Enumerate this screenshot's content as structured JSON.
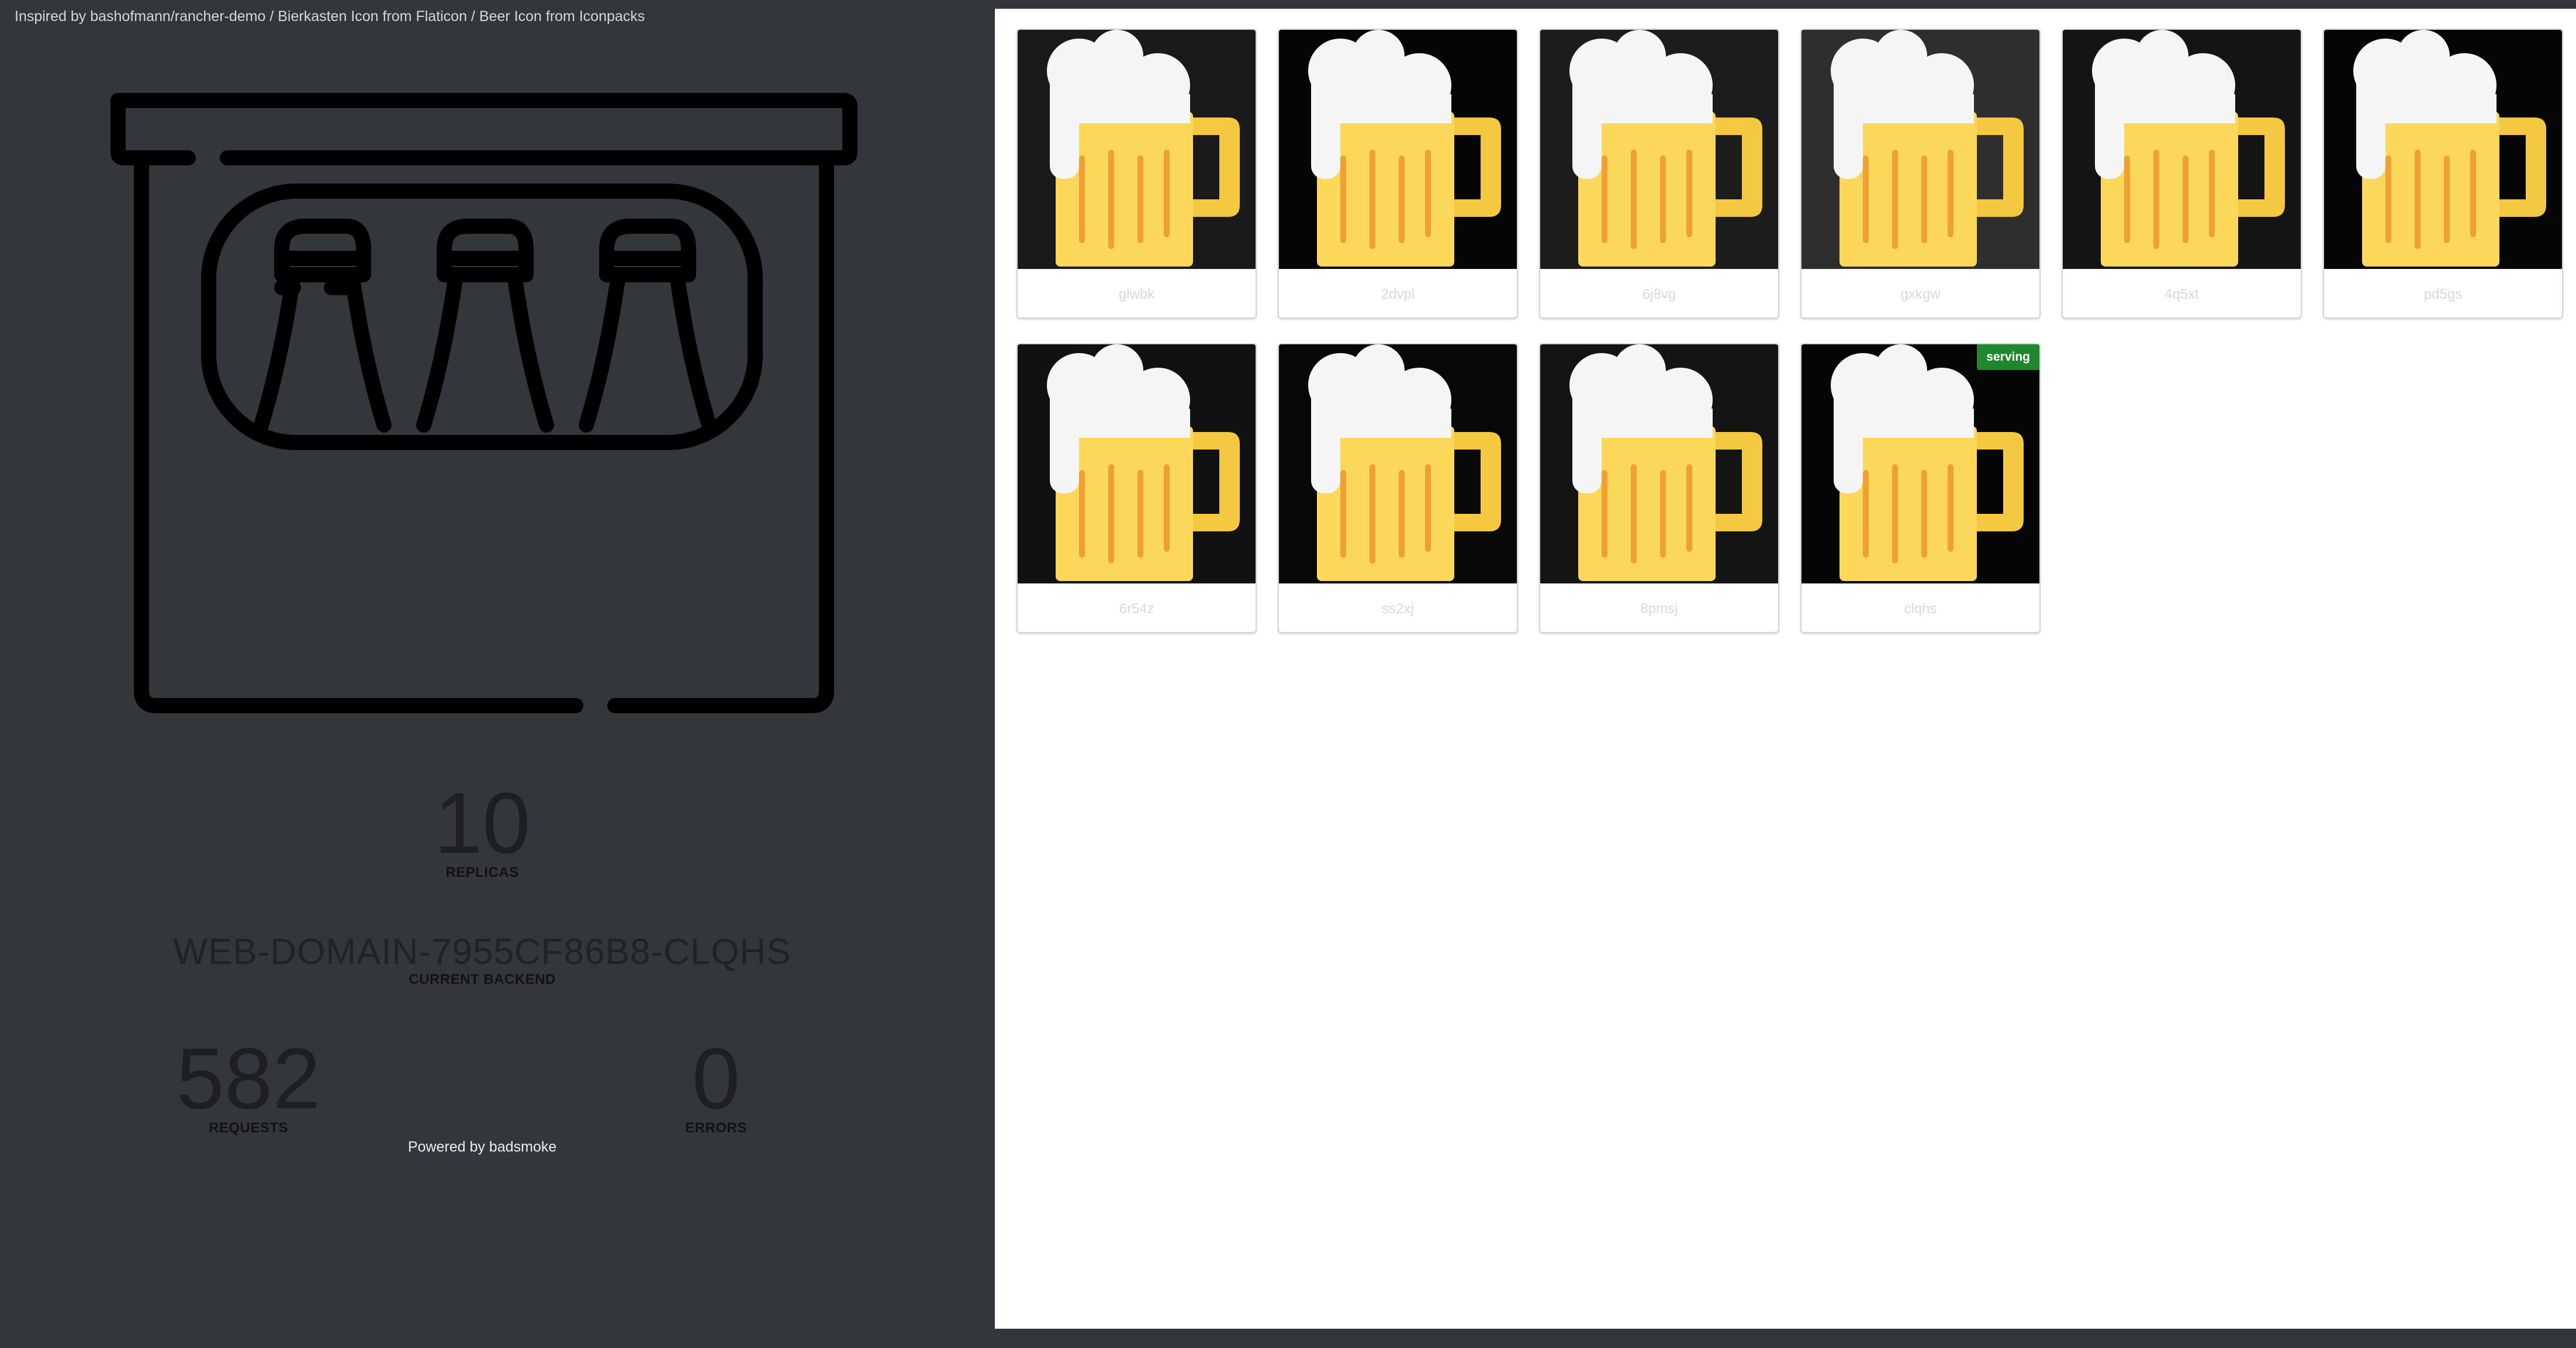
{
  "credits": "Inspired by bashofmann/rancher-demo / Bierkasten Icon from Flaticon / Beer Icon from Iconpacks",
  "icons": {
    "hero": "beer-crate-icon",
    "card": "beer-mug-icon"
  },
  "colors": {
    "accent_serving": "#21872f",
    "left_bg": "#33373c",
    "panel_bg": "#ffffff"
  },
  "stats": {
    "replicas_value": "10",
    "replicas_label": "REPLICAS",
    "backend_value": "WEB-DOMAIN-7955CF86B8-CLQHS",
    "backend_label": "CURRENT BACKEND",
    "requests_value": "582",
    "requests_label": "REQUESTS",
    "errors_value": "0",
    "errors_label": "ERRORS"
  },
  "powered_by": "Powered by badsmoke",
  "cards": [
    {
      "name": "glwbk",
      "bg": "#1a1a1a"
    },
    {
      "name": "2dvpl",
      "bg": "#050505"
    },
    {
      "name": "6j8vg",
      "bg": "#1c1c1c"
    },
    {
      "name": "gxkgw",
      "bg": "#2e2e2e"
    },
    {
      "name": "4q5xt",
      "bg": "#141414"
    },
    {
      "name": "pd5gs",
      "bg": "#050505"
    },
    {
      "name": "6r54z",
      "bg": "#111111"
    },
    {
      "name": "ss2xj",
      "bg": "#080808"
    },
    {
      "name": "8pmsj",
      "bg": "#141414"
    },
    {
      "name": "clqhs",
      "bg": "#050505",
      "badge": "serving"
    }
  ]
}
